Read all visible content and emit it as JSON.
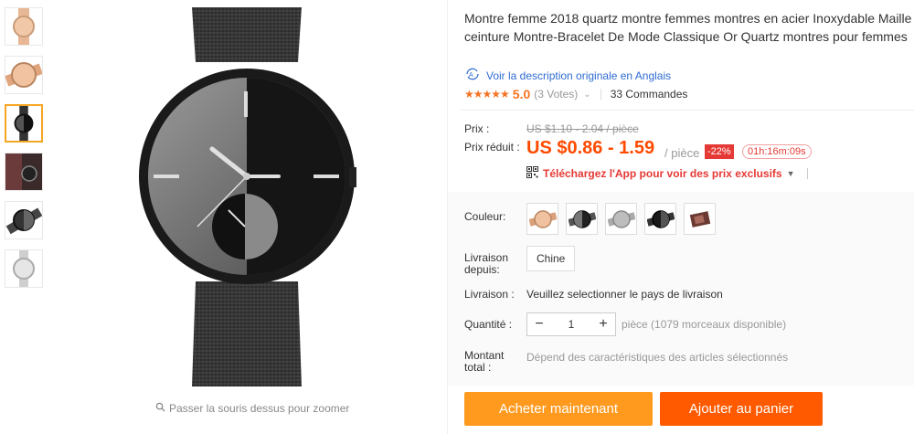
{
  "product": {
    "title": "Montre femme 2018 quartz montre femmes montres en acier Inoxydable Maille ceinture Montre-Bracelet De Mode Classique Or Quartz montres pour femmes",
    "original_link": "Voir la description originale en Anglais",
    "stars": "★★★★★",
    "score": "5.0",
    "votes": "(3 Votes)",
    "orders": "33 Commandes"
  },
  "gallery": {
    "zoom_hint": "Passer la souris dessus pour zoomer"
  },
  "pricing": {
    "price_label": "Prix :",
    "old_price": "US $1.10 - 2.04 / pièce",
    "reduced_label": "Prix réduit :",
    "price": "US $0.86 - 1.59",
    "unit": "/ pièce",
    "discount": "-22%",
    "timer": "01h:16m:09s",
    "app_promo": "Téléchargez l'App pour voir des prix exclusifs"
  },
  "options": {
    "color_label": "Couleur:",
    "ship_from_label_1": "Livraison",
    "ship_from_label_2": "depuis:",
    "ship_from_value": "Chine",
    "shipping_label": "Livraison :",
    "shipping_value": "Veuillez selectionner le pays de livraison",
    "qty_label": "Quantité :",
    "qty_value": "1",
    "qty_available": "pièce (1079 morceaux disponible)",
    "total_label_1": "Montant",
    "total_label_2": "total :",
    "total_value": "Dépend des caractéristiques des articles sélectionnés"
  },
  "actions": {
    "buy_now": "Acheter maintenant",
    "add_to_cart": "Ajouter au panier"
  },
  "colors": {
    "accent": "#ff4a00",
    "buy": "#ff9a1f",
    "cart": "#ff5a00",
    "link": "#2f6bd1"
  }
}
